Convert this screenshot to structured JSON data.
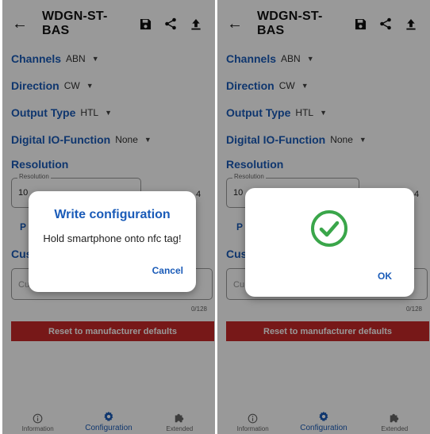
{
  "app": {
    "title": "WDGN-ST-BAS",
    "icons": {
      "back": "arrow-left-icon",
      "save": "floppy-disk-icon",
      "share": "share-icon",
      "upload": "upload-icon"
    }
  },
  "settings": {
    "channels": {
      "label": "Channels",
      "value": "ABN"
    },
    "direction": {
      "label": "Direction",
      "value": "CW"
    },
    "output_type": {
      "label": "Output Type",
      "value": "HTL"
    },
    "digital_io": {
      "label": "Digital IO-Function",
      "value": "None"
    },
    "resolution": {
      "title": "Resolution",
      "legend": "Resolution",
      "value": "10",
      "side_value": "4"
    },
    "partial_left": "P",
    "custom_title_partial": "Cus",
    "custom_field_partial": "Cu",
    "custom_counter": "0/128"
  },
  "reset_button": "Reset to manufacturer defaults",
  "nav": {
    "items": [
      {
        "label": "Information",
        "icon": "info-icon"
      },
      {
        "label": "Configuration",
        "icon": "gear-icon"
      },
      {
        "label": "Extended",
        "icon": "puzzle-icon"
      }
    ],
    "active_index": 1
  },
  "dialog_write": {
    "title": "Write configuration",
    "message": "Hold smartphone onto nfc tag!",
    "button": "Cancel"
  },
  "dialog_success": {
    "icon": "check-circle-icon",
    "button": "OK"
  },
  "colors": {
    "accent": "#1a5bb8",
    "danger": "#c62828",
    "success": "#3aa64a"
  }
}
